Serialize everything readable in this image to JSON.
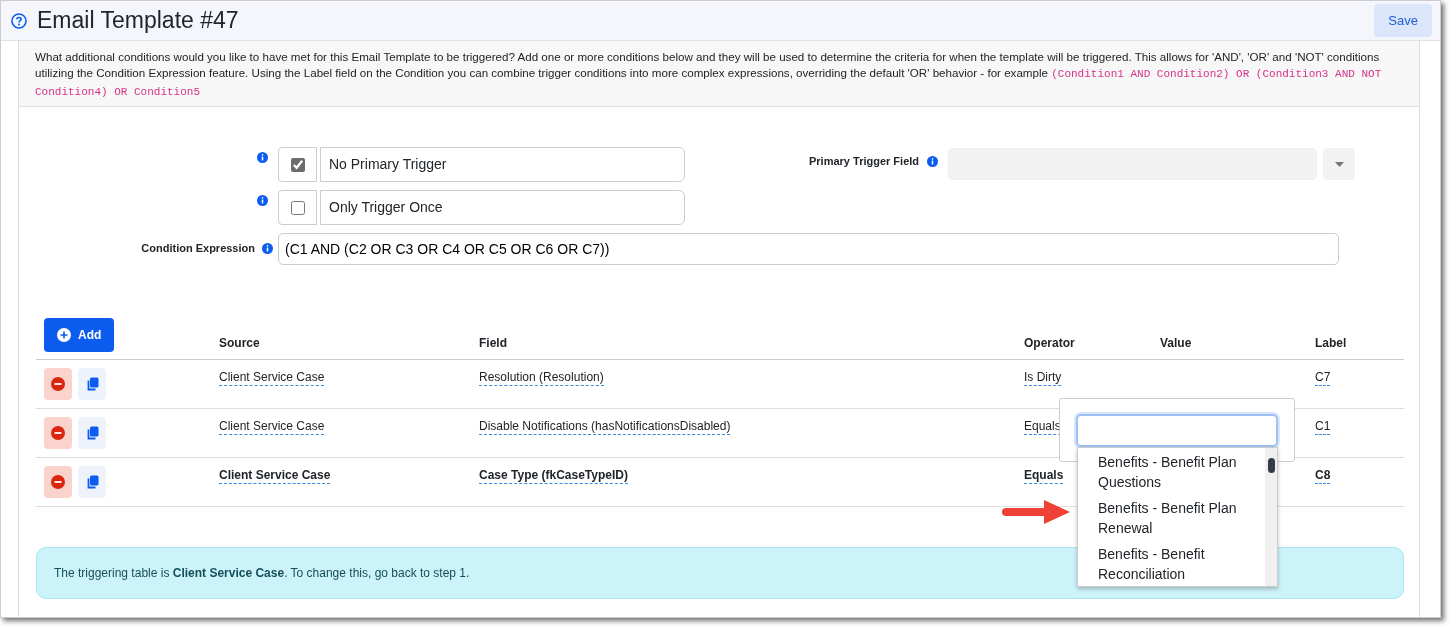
{
  "header": {
    "title": "Email Template #47",
    "save_label": "Save"
  },
  "description": [
    {
      "kind": "text",
      "text": "What additional conditions would you like to have met for this Email Template to be triggered? Add one or more conditions below and they will be used to determine the criteria for when the template will be triggered. This allows for 'AND', 'OR' and 'NOT' conditions utilizing the Condition Expression feature. Using the Label field on the Condition you can combine trigger conditions into more complex expressions, overriding the default 'OR' behavior - for example "
    },
    {
      "kind": "code",
      "text": "(Condition1 AND Condition2) OR (Condition3 AND NOT Condition4) OR Condition5"
    }
  ],
  "options": [
    {
      "label": "No Primary Trigger",
      "checked": true
    },
    {
      "label": "Only Trigger Once",
      "checked": false
    }
  ],
  "primary_trigger_field": {
    "label": "Primary Trigger Field",
    "disabled": true
  },
  "condition_expression": {
    "label": "Condition Expression",
    "value": "(C1 AND (C2 OR C3 OR C4 OR C5 OR C6 OR C7))"
  },
  "add_label": "Add",
  "table": {
    "columns": [
      "Source",
      "Field",
      "Operator",
      "Value",
      "Label"
    ],
    "rows": [
      {
        "source": "Client Service Case",
        "field": "Resolution (Resolution)",
        "operator": "Is Dirty",
        "label": "C7",
        "emphasized": false
      },
      {
        "source": "Client Service Case",
        "field": "Disable Notifications (hasNotificationsDisabled)",
        "operator": "Equals",
        "label": "C1",
        "emphasized": false
      },
      {
        "source": "Client Service Case",
        "field": "Case Type (fkCaseTypeID)",
        "operator": "Equals",
        "label": "C8",
        "emphasized": true
      }
    ]
  },
  "value_dropdown": {
    "options": [
      "Benefits - Benefit Plan Questions",
      "Benefits - Benefit Plan Renewal",
      "Benefits - Benefit Reconciliation"
    ]
  },
  "alert": "The triggering table is **Client Service Case**. To change this, go back to step 1."
}
